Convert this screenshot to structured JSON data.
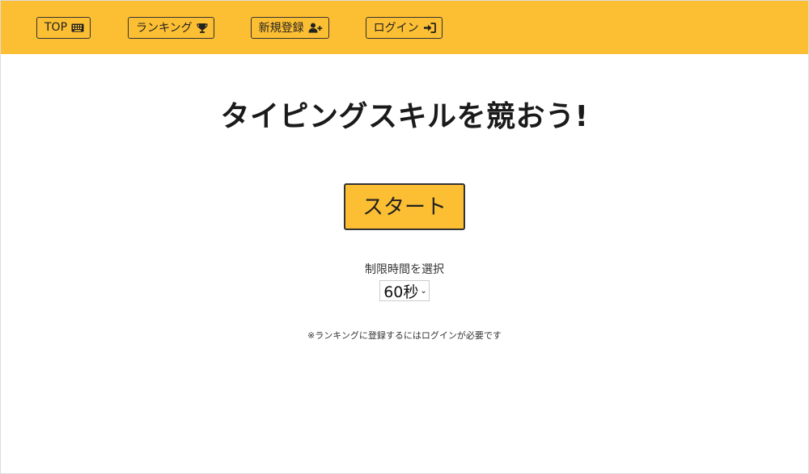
{
  "nav": {
    "top_label": "TOP",
    "ranking_label": "ランキング",
    "register_label": "新規登録",
    "login_label": "ログイン"
  },
  "main": {
    "title": "タイピングスキルを競おう!",
    "start_label": "スタート",
    "time_label": "制限時間を選択",
    "time_selected": "60秒",
    "note": "※ランキングに登録するにはログインが必要です"
  },
  "colors": {
    "accent": "#fcbe32",
    "border": "#333333"
  },
  "icons": {
    "top": "keyboard-icon",
    "ranking": "trophy-icon",
    "register": "user-plus-icon",
    "login": "sign-in-icon"
  }
}
